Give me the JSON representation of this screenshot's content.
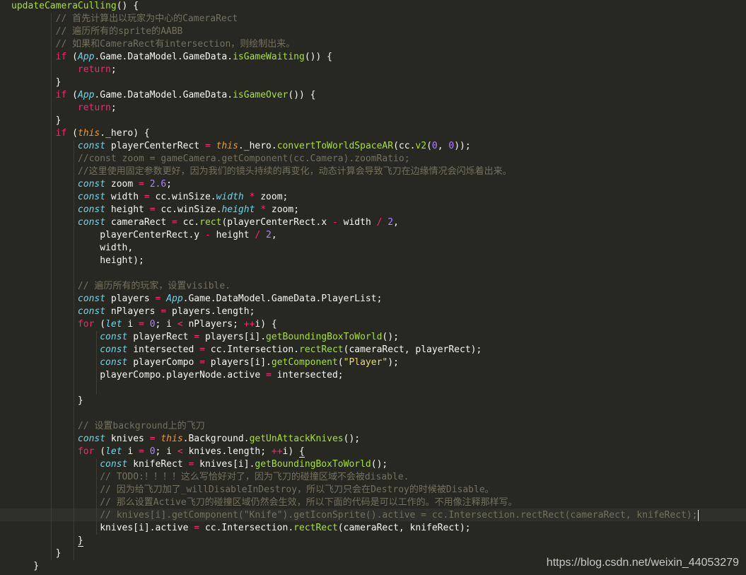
{
  "editor": {
    "theme": "monokai",
    "colors": {
      "background": "#272822",
      "text": "#f8f8f2",
      "function": "#a6e22e",
      "keyword": "#f92672",
      "storage": "#66d9ef",
      "this": "#fd971f",
      "number": "#ae81ff",
      "string": "#e6db74",
      "comment": "#75715e"
    },
    "lines": [
      [
        {
          "t": "updateCameraCulling",
          "c": "fn"
        },
        {
          "t": "() {"
        }
      ],
      [
        {
          "t": "        "
        },
        {
          "t": "// 首先计算出以玩家为中心的CameraRect",
          "c": "cm"
        }
      ],
      [
        {
          "t": "        "
        },
        {
          "t": "// 遍历所有的sprite的AABB",
          "c": "cm"
        }
      ],
      [
        {
          "t": "        "
        },
        {
          "t": "// 如果和CameraRect有intersection，则绘制出来。",
          "c": "cm"
        }
      ],
      [
        {
          "t": "        "
        },
        {
          "t": "if",
          "c": "kw"
        },
        {
          "t": " ("
        },
        {
          "t": "App",
          "c": "st"
        },
        {
          "t": ".Game.DataModel.GameData."
        },
        {
          "t": "isGameWaiting",
          "c": "fn"
        },
        {
          "t": "()) {"
        }
      ],
      [
        {
          "t": "            "
        },
        {
          "t": "return",
          "c": "kw"
        },
        {
          "t": ";"
        }
      ],
      [
        {
          "t": "        }"
        }
      ],
      [
        {
          "t": "        "
        },
        {
          "t": "if",
          "c": "kw"
        },
        {
          "t": " ("
        },
        {
          "t": "App",
          "c": "st"
        },
        {
          "t": ".Game.DataModel.GameData."
        },
        {
          "t": "isGameOver",
          "c": "fn"
        },
        {
          "t": "()) {"
        }
      ],
      [
        {
          "t": "            "
        },
        {
          "t": "return",
          "c": "kw"
        },
        {
          "t": ";"
        }
      ],
      [
        {
          "t": "        }"
        }
      ],
      [
        {
          "t": "        "
        },
        {
          "t": "if",
          "c": "kw"
        },
        {
          "t": " ("
        },
        {
          "t": "this",
          "c": "th"
        },
        {
          "t": "._hero) {"
        }
      ],
      [
        {
          "t": "            "
        },
        {
          "t": "const",
          "c": "st"
        },
        {
          "t": " playerCenterRect "
        },
        {
          "t": "=",
          "c": "op"
        },
        {
          "t": " "
        },
        {
          "t": "this",
          "c": "th"
        },
        {
          "t": "._hero."
        },
        {
          "t": "convertToWorldSpaceAR",
          "c": "fn"
        },
        {
          "t": "(cc."
        },
        {
          "t": "v2",
          "c": "fn"
        },
        {
          "t": "("
        },
        {
          "t": "0",
          "c": "num"
        },
        {
          "t": ", "
        },
        {
          "t": "0",
          "c": "num"
        },
        {
          "t": "));"
        }
      ],
      [
        {
          "t": "            "
        },
        {
          "t": "//const zoom = gameCamera.getComponent(cc.Camera).zoomRatio;",
          "c": "cm"
        }
      ],
      [
        {
          "t": "            "
        },
        {
          "t": "//这里使用固定参数更好，因为我们的镜头持续的再变化，动态计算会导致飞刀在边缘情况会闪烁着出来。",
          "c": "cm"
        }
      ],
      [
        {
          "t": "            "
        },
        {
          "t": "const",
          "c": "st"
        },
        {
          "t": " zoom "
        },
        {
          "t": "=",
          "c": "op"
        },
        {
          "t": " "
        },
        {
          "t": "2.6",
          "c": "num"
        },
        {
          "t": ";"
        }
      ],
      [
        {
          "t": "            "
        },
        {
          "t": "const",
          "c": "st"
        },
        {
          "t": " width "
        },
        {
          "t": "=",
          "c": "op"
        },
        {
          "t": " cc.winSize."
        },
        {
          "t": "width",
          "c": "st"
        },
        {
          "t": " "
        },
        {
          "t": "*",
          "c": "op"
        },
        {
          "t": " zoom;"
        }
      ],
      [
        {
          "t": "            "
        },
        {
          "t": "const",
          "c": "st"
        },
        {
          "t": " height "
        },
        {
          "t": "=",
          "c": "op"
        },
        {
          "t": " cc.winSize."
        },
        {
          "t": "height",
          "c": "st"
        },
        {
          "t": " "
        },
        {
          "t": "*",
          "c": "op"
        },
        {
          "t": " zoom;"
        }
      ],
      [
        {
          "t": "            "
        },
        {
          "t": "const",
          "c": "st"
        },
        {
          "t": " cameraRect "
        },
        {
          "t": "=",
          "c": "op"
        },
        {
          "t": " cc."
        },
        {
          "t": "rect",
          "c": "fn"
        },
        {
          "t": "(playerCenterRect.x "
        },
        {
          "t": "-",
          "c": "op"
        },
        {
          "t": " width "
        },
        {
          "t": "/",
          "c": "op"
        },
        {
          "t": " "
        },
        {
          "t": "2",
          "c": "num"
        },
        {
          "t": ","
        }
      ],
      [
        {
          "t": "                playerCenterRect.y "
        },
        {
          "t": "-",
          "c": "op"
        },
        {
          "t": " height "
        },
        {
          "t": "/",
          "c": "op"
        },
        {
          "t": " "
        },
        {
          "t": "2",
          "c": "num"
        },
        {
          "t": ","
        }
      ],
      [
        {
          "t": "                width,"
        }
      ],
      [
        {
          "t": "                height);"
        }
      ],
      [
        {
          "t": ""
        }
      ],
      [
        {
          "t": "            "
        },
        {
          "t": "// 遍历所有的玩家，设置visible.",
          "c": "cm"
        }
      ],
      [
        {
          "t": "            "
        },
        {
          "t": "const",
          "c": "st"
        },
        {
          "t": " players "
        },
        {
          "t": "=",
          "c": "op"
        },
        {
          "t": " "
        },
        {
          "t": "App",
          "c": "st"
        },
        {
          "t": ".Game.DataModel.GameData.PlayerList;"
        }
      ],
      [
        {
          "t": "            "
        },
        {
          "t": "const",
          "c": "st"
        },
        {
          "t": " nPlayers "
        },
        {
          "t": "=",
          "c": "op"
        },
        {
          "t": " players.length;"
        }
      ],
      [
        {
          "t": "            "
        },
        {
          "t": "for",
          "c": "kw"
        },
        {
          "t": " ("
        },
        {
          "t": "let",
          "c": "st"
        },
        {
          "t": " i "
        },
        {
          "t": "=",
          "c": "op"
        },
        {
          "t": " "
        },
        {
          "t": "0",
          "c": "num"
        },
        {
          "t": "; i "
        },
        {
          "t": "<",
          "c": "op"
        },
        {
          "t": " nPlayers; "
        },
        {
          "t": "++",
          "c": "op"
        },
        {
          "t": "i) {"
        }
      ],
      [
        {
          "t": "                "
        },
        {
          "t": "const",
          "c": "st"
        },
        {
          "t": " playerRect "
        },
        {
          "t": "=",
          "c": "op"
        },
        {
          "t": " players[i]."
        },
        {
          "t": "getBoundingBoxToWorld",
          "c": "fn"
        },
        {
          "t": "();"
        }
      ],
      [
        {
          "t": "                "
        },
        {
          "t": "const",
          "c": "st"
        },
        {
          "t": " intersected "
        },
        {
          "t": "=",
          "c": "op"
        },
        {
          "t": " cc.Intersection."
        },
        {
          "t": "rectRect",
          "c": "fn"
        },
        {
          "t": "(cameraRect, playerRect);"
        }
      ],
      [
        {
          "t": "                "
        },
        {
          "t": "const",
          "c": "st"
        },
        {
          "t": " playerCompo "
        },
        {
          "t": "=",
          "c": "op"
        },
        {
          "t": " players[i]."
        },
        {
          "t": "getComponent",
          "c": "fn"
        },
        {
          "t": "("
        },
        {
          "t": "\"Player\"",
          "c": "str"
        },
        {
          "t": ");"
        }
      ],
      [
        {
          "t": "                playerCompo.playerNode.active "
        },
        {
          "t": "=",
          "c": "op"
        },
        {
          "t": " intersected;"
        }
      ],
      [
        {
          "t": ""
        }
      ],
      [
        {
          "t": "            }"
        }
      ],
      [
        {
          "t": ""
        }
      ],
      [
        {
          "t": "            "
        },
        {
          "t": "// 设置background上的飞刀",
          "c": "cm"
        }
      ],
      [
        {
          "t": "            "
        },
        {
          "t": "const",
          "c": "st"
        },
        {
          "t": " knives "
        },
        {
          "t": "=",
          "c": "op"
        },
        {
          "t": " "
        },
        {
          "t": "this",
          "c": "th"
        },
        {
          "t": ".Background."
        },
        {
          "t": "getUnAttackKnives",
          "c": "fn"
        },
        {
          "t": "();"
        }
      ],
      [
        {
          "t": "            "
        },
        {
          "t": "for",
          "c": "kw"
        },
        {
          "t": " ("
        },
        {
          "t": "let",
          "c": "st"
        },
        {
          "t": " i "
        },
        {
          "t": "=",
          "c": "op"
        },
        {
          "t": " "
        },
        {
          "t": "0",
          "c": "num"
        },
        {
          "t": "; i "
        },
        {
          "t": "<",
          "c": "op"
        },
        {
          "t": " knives.length; "
        },
        {
          "t": "++",
          "c": "op"
        },
        {
          "t": "i) "
        },
        {
          "t": "{",
          "c": "bracket"
        }
      ],
      [
        {
          "t": "                "
        },
        {
          "t": "const",
          "c": "st"
        },
        {
          "t": " knifeRect "
        },
        {
          "t": "=",
          "c": "op"
        },
        {
          "t": " knives[i]."
        },
        {
          "t": "getBoundingBoxToWorld",
          "c": "fn"
        },
        {
          "t": "();"
        }
      ],
      [
        {
          "t": "                "
        },
        {
          "t": "// TODO:！！！！这么写恰好对了，因为飞刀的碰撞区域不会被disable.",
          "c": "cm"
        }
      ],
      [
        {
          "t": "                "
        },
        {
          "t": "// 因为给飞刀加了_willDisableInDestroy，所以飞刀只会在Destroy的时候被Disable。",
          "c": "cm"
        }
      ],
      [
        {
          "t": "                "
        },
        {
          "t": "// 那么设置Active飞刀的碰撞区域仍然会生效，所以下面的代码是可以工作的。不用像注释那样写。",
          "c": "cm"
        }
      ],
      [
        {
          "t": "                "
        },
        {
          "t": "// knives[i].getComponent(\"Knife\").getIconSprite().active = cc.Intersection.rectRect(cameraRect, knifeRect);",
          "c": "cm"
        },
        {
          "cursor": true
        }
      ],
      [
        {
          "t": "                knives[i].active "
        },
        {
          "t": "=",
          "c": "op"
        },
        {
          "t": " cc.Intersection."
        },
        {
          "t": "rectRect",
          "c": "fn"
        },
        {
          "t": "(cameraRect, knifeRect);"
        }
      ],
      [
        {
          "t": "            "
        },
        {
          "t": "}",
          "c": "bracket"
        }
      ],
      [
        {
          "t": "        }"
        }
      ],
      [
        {
          "t": "    }"
        }
      ]
    ]
  },
  "watermark": "https://blog.csdn.net/weixin_44053279"
}
